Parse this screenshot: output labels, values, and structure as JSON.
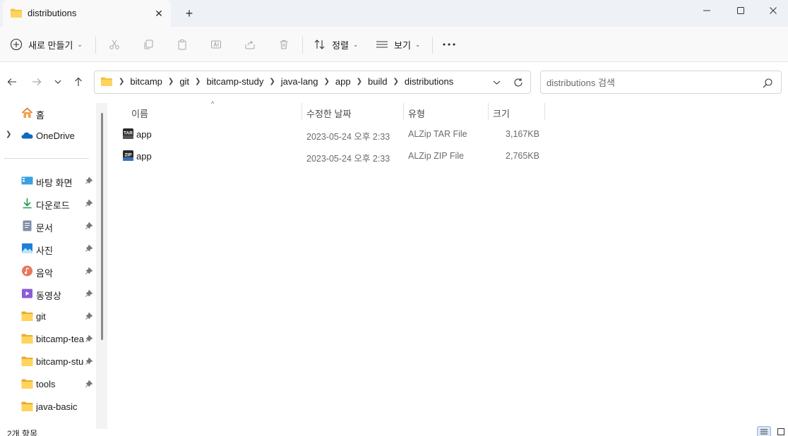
{
  "window": {
    "tab_title": "distributions",
    "new_tab": "+",
    "close_tab": "✕"
  },
  "toolbar": {
    "new_label": "새로 만들기",
    "sort_label": "정렬",
    "view_label": "보기",
    "more": "···"
  },
  "address": {
    "crumbs": [
      "bitcamp",
      "git",
      "bitcamp-study",
      "java-lang",
      "app",
      "build",
      "distributions"
    ]
  },
  "search": {
    "placeholder": "distributions 검색"
  },
  "sidebar": {
    "home": "홈",
    "onedrive": "OneDrive",
    "pinned": [
      {
        "label": "바탕 화면",
        "icon": "desktop-icon"
      },
      {
        "label": "다운로드",
        "icon": "download-icon"
      },
      {
        "label": "문서",
        "icon": "document-icon"
      },
      {
        "label": "사진",
        "icon": "pictures-icon"
      },
      {
        "label": "음악",
        "icon": "music-icon"
      },
      {
        "label": "동영상",
        "icon": "video-icon"
      },
      {
        "label": "git",
        "icon": "folder-icon"
      },
      {
        "label": "bitcamp-teac",
        "icon": "folder-icon"
      },
      {
        "label": "bitcamp-stuc",
        "icon": "folder-icon"
      },
      {
        "label": "tools",
        "icon": "folder-icon"
      },
      {
        "label": "java-basic",
        "icon": "folder-icon"
      }
    ]
  },
  "columns": {
    "name": "이름",
    "modified": "수정한 날짜",
    "type": "유형",
    "size": "크기"
  },
  "files": [
    {
      "name": "app",
      "modified": "2023-05-24 오후 2:33",
      "type": "ALZip TAR File",
      "size": "3,167KB",
      "icon": "tar-archive-icon"
    },
    {
      "name": "app",
      "modified": "2023-05-24 오후 2:33",
      "type": "ALZip ZIP File",
      "size": "2,765KB",
      "icon": "zip-archive-icon"
    }
  ],
  "status": {
    "count": "2개 항목"
  },
  "colors": {
    "folder": "#f4c244",
    "accent": "#0067c0"
  }
}
